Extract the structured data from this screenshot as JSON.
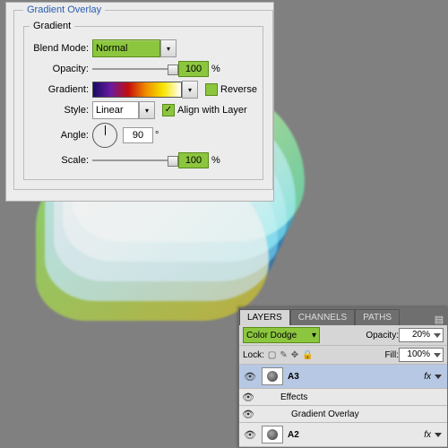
{
  "gradient_overlay": {
    "panel_title": "Gradient Overlay",
    "group_title": "Gradient",
    "blend_mode_label": "Blend Mode:",
    "blend_mode_value": "Normal",
    "opacity_label": "Opacity:",
    "opacity_value": "100",
    "opacity_unit": "%",
    "gradient_label": "Gradient:",
    "reverse_label": "Reverse",
    "reverse_checked": false,
    "style_label": "Style:",
    "style_value": "Linear",
    "align_label": "Align with Layer",
    "align_checked": true,
    "angle_label": "Angle:",
    "angle_value": "90",
    "angle_unit": "°",
    "scale_label": "Scale:",
    "scale_value": "100",
    "scale_unit": "%"
  },
  "layers_panel": {
    "tabs": {
      "layers": "LAYERS",
      "channels": "CHANNELS",
      "paths": "PATHS"
    },
    "blend_mode": "Color Dodge",
    "opacity_label": "Opacity:",
    "opacity_value": "20%",
    "lock_label": "Lock:",
    "fill_label": "Fill:",
    "fill_value": "100%",
    "items": {
      "a3": "A3",
      "effects": "Effects",
      "gradient_overlay": "Gradient Overlay",
      "a2": "A2"
    },
    "fx_label": "fx"
  }
}
